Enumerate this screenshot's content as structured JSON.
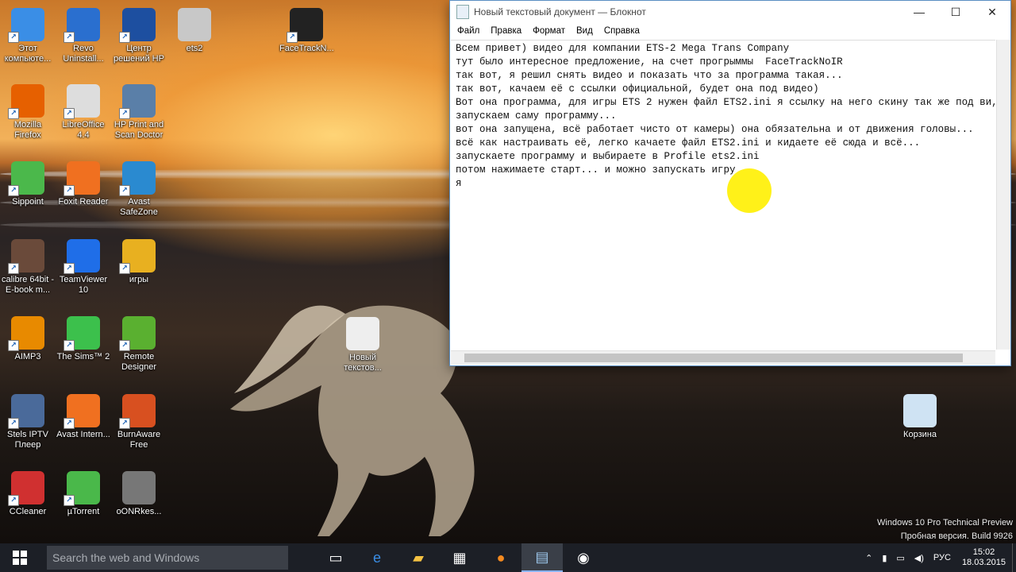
{
  "desktop_icons": [
    {
      "label": "Этот компьюте...",
      "icon": "this-pc-icon"
    },
    {
      "label": "Revo Uninstall...",
      "icon": "revo-uninstaller-icon"
    },
    {
      "label": "Центр решений HP",
      "icon": "hp-center-icon"
    },
    {
      "label": "ets2",
      "icon": "settings-file-icon"
    },
    {
      "label": "FaceTrackN...",
      "icon": "facetrack-icon"
    },
    {
      "label": "Mozilla Firefox",
      "icon": "firefox-icon"
    },
    {
      "label": "LibreOffice 4.4",
      "icon": "libreoffice-icon"
    },
    {
      "label": "HP Print and Scan Doctor",
      "icon": "hp-print-icon"
    },
    {
      "label": "Sippoint",
      "icon": "sippoint-icon"
    },
    {
      "label": "Foxit Reader",
      "icon": "foxit-icon"
    },
    {
      "label": "Avast SafeZone",
      "icon": "avast-safezone-icon"
    },
    {
      "label": "calibre 64bit - E-book m...",
      "icon": "calibre-icon"
    },
    {
      "label": "TeamViewer 10",
      "icon": "teamviewer-icon"
    },
    {
      "label": "игры",
      "icon": "folder-icon"
    },
    {
      "label": "AIMP3",
      "icon": "aimp-icon"
    },
    {
      "label": "The Sims™ 2",
      "icon": "sims-icon"
    },
    {
      "label": "Remote Designer",
      "icon": "remote-designer-icon"
    },
    {
      "label": "Stels IPTV Плеер",
      "icon": "iptv-icon"
    },
    {
      "label": "Avast Intern...",
      "icon": "avast-icon"
    },
    {
      "label": "BurnAware Free",
      "icon": "burnaware-icon"
    },
    {
      "label": "CCleaner",
      "icon": "ccleaner-icon"
    },
    {
      "label": "µTorrent",
      "icon": "utorrent-icon"
    },
    {
      "label": "oONRkes...",
      "icon": "photo-icon"
    },
    {
      "label": "Новый текстов...",
      "icon": "text-file-icon"
    },
    {
      "label": "Корзина",
      "icon": "recycle-bin-icon"
    }
  ],
  "notepad": {
    "title": "Новый текстовый документ — Блокнот",
    "minimize": "—",
    "maximize": "☐",
    "close": "✕",
    "menu": [
      "Файл",
      "Правка",
      "Формат",
      "Вид",
      "Справка"
    ],
    "lines": [
      "Всем привет) видео для компании ETS-2 Mega Trans Company",
      "тут было интересное предложение, на счет прогрыммы  FaceTrackNoIR",
      "так вот, я решил снять видео и показать что за программа такая...",
      "так вот, качаем её с ссылки официальной, будет она под видео)",
      "Вот она программа, для игры ETS 2 нужен файл ETS2.ini я ссылку на него скину так же под ви,",
      "запускаем саму программу...",
      "вот она запущена, всё работает чисто от камеры) она обязательна и от движения головы...",
      "всё как настраивать её, легко качаете файл ETS2.ini и кидаете её сюда и всё...",
      "запускаете программу и выбираете в Profile ets2.ini",
      "потом нажимаете старт... и можно запускать игру",
      "я "
    ]
  },
  "taskbar": {
    "search_placeholder": "Search the web and Windows",
    "language": "РУС",
    "time": "15:02",
    "date": "18.03.2015"
  },
  "watermark": {
    "line1": "Windows 10 Pro Technical Preview",
    "line2": "Пробная версия. Build 9926"
  }
}
